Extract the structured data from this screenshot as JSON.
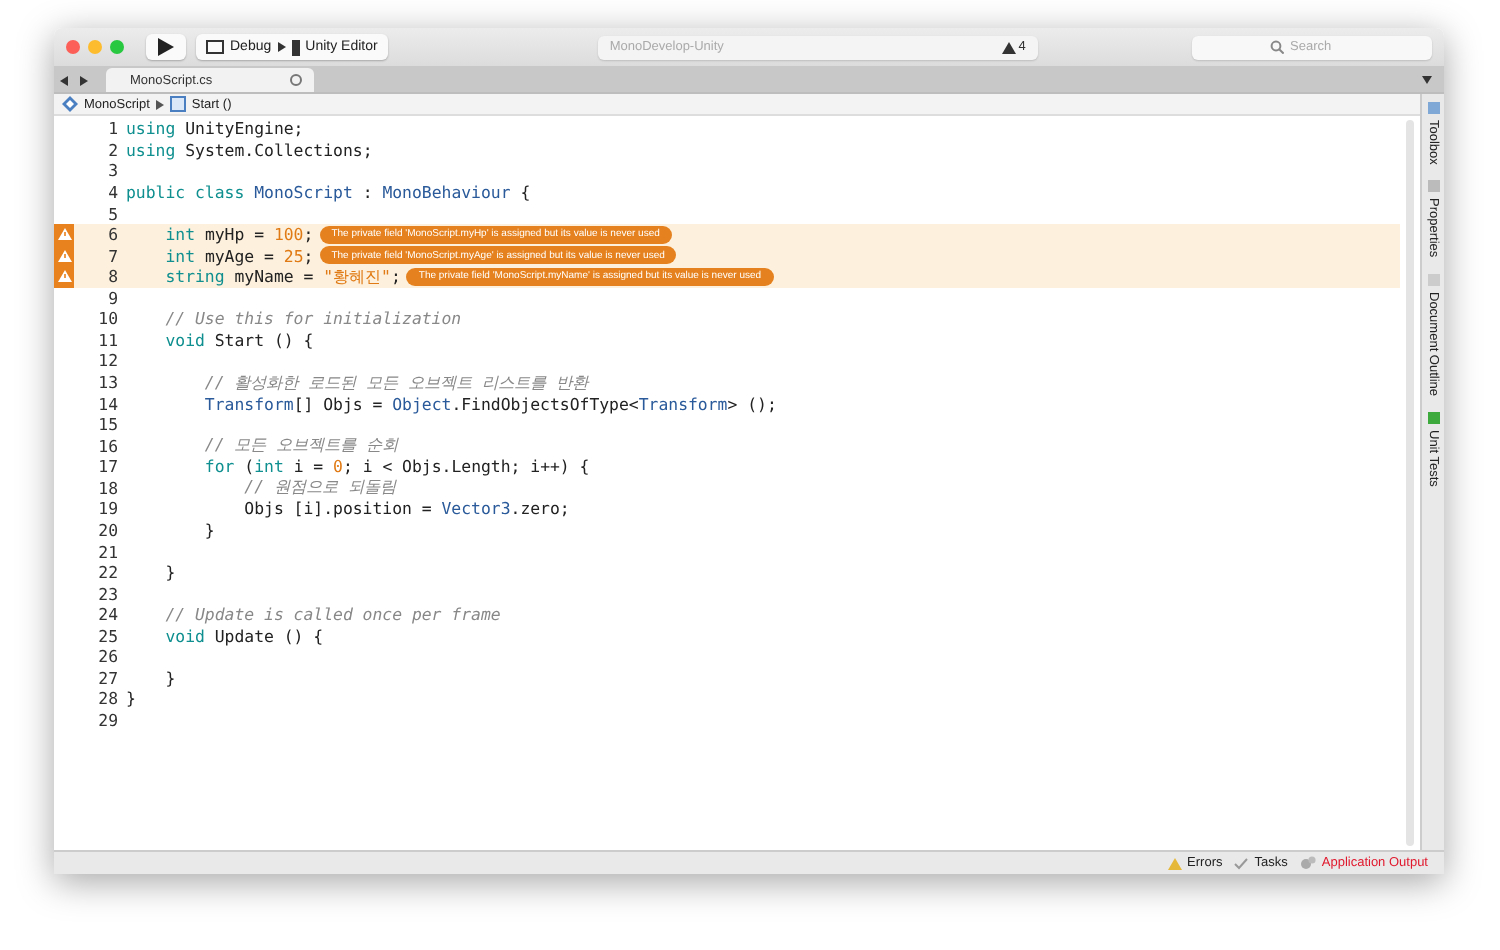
{
  "toolbar": {
    "configuration": "Debug",
    "target": "Unity Editor",
    "status": "MonoDevelop-Unity",
    "warning_count": "4",
    "search": {
      "placeholder": "Search"
    }
  },
  "tabs": [
    {
      "label": "MonoScript.cs",
      "selected": true
    }
  ],
  "breadcrumb": [
    "MonoScript",
    "Start ()"
  ],
  "lines": [
    {
      "number": "1",
      "warning": false,
      "tokens": [
        {
          "kind": "keyword",
          "text": "using"
        },
        {
          "kind": "text",
          "text": " UnityEngine;"
        }
      ]
    },
    {
      "number": "2",
      "warning": false,
      "tokens": [
        {
          "kind": "keyword",
          "text": "using"
        },
        {
          "kind": "text",
          "text": " System.Collections;"
        }
      ]
    },
    {
      "number": "3",
      "warning": false
    },
    {
      "number": "4",
      "warning": false,
      "tokens": [
        {
          "kind": "keyword",
          "text": "public class"
        },
        {
          "kind": "type",
          "text": " MonoScript"
        },
        {
          "kind": "text",
          "text": " : "
        },
        {
          "kind": "type",
          "text": "MonoBehaviour"
        },
        {
          "kind": "text",
          "text": " {"
        }
      ]
    },
    {
      "number": "5",
      "warning": false
    },
    {
      "number": "6",
      "warning": true,
      "message": "The private field 'MonoScript.myHp' is assigned but its value is never used",
      "tokens": [
        {
          "kind": "keyword",
          "text": "    int"
        },
        {
          "kind": "text",
          "text": " myHp = "
        },
        {
          "kind": "number",
          "text": "100"
        },
        {
          "kind": "text",
          "text": ";"
        }
      ]
    },
    {
      "number": "7",
      "warning": true,
      "message": "The private field 'MonoScript.myAge' is assigned but its value is never used",
      "tokens": [
        {
          "kind": "keyword",
          "text": "    int"
        },
        {
          "kind": "text",
          "text": " myAge = "
        },
        {
          "kind": "number",
          "text": "25"
        },
        {
          "kind": "text",
          "text": ";"
        }
      ]
    },
    {
      "number": "8",
      "warning": true,
      "message": "The private field 'MonoScript.myName' is assigned but its value is never used",
      "tokens": [
        {
          "kind": "keyword",
          "text": "    string"
        },
        {
          "kind": "text",
          "text": " myName = "
        },
        {
          "kind": "string",
          "text": "\"황혜진\""
        },
        {
          "kind": "text",
          "text": ";"
        }
      ]
    },
    {
      "number": "9",
      "warning": false
    },
    {
      "number": "10",
      "warning": false,
      "tokens": [
        {
          "kind": "comment",
          "text": "    // Use this for initialization"
        }
      ]
    },
    {
      "number": "11",
      "warning": false,
      "tokens": [
        {
          "kind": "keyword",
          "text": "    void"
        },
        {
          "kind": "text",
          "text": " Start () {"
        }
      ]
    },
    {
      "number": "12",
      "warning": false
    },
    {
      "number": "13",
      "warning": false,
      "tokens": [
        {
          "kind": "comment",
          "text": "        // 활성화한 로드된 모든 오브젝트 리스트를 반환"
        }
      ]
    },
    {
      "number": "14",
      "warning": false,
      "tokens": [
        {
          "kind": "type",
          "text": "        Transform"
        },
        {
          "kind": "text",
          "text": "[] Objs = "
        },
        {
          "kind": "type",
          "text": "Object"
        },
        {
          "kind": "text",
          "text": ".FindObjectsOfType<"
        },
        {
          "kind": "type",
          "text": "Transform"
        },
        {
          "kind": "text",
          "text": "> ();"
        }
      ]
    },
    {
      "number": "15",
      "warning": false
    },
    {
      "number": "16",
      "warning": false,
      "tokens": [
        {
          "kind": "comment",
          "text": "        // 모든 오브젝트를 순회"
        }
      ]
    },
    {
      "number": "17",
      "warning": false,
      "tokens": [
        {
          "kind": "keyword",
          "text": "        for"
        },
        {
          "kind": "text",
          "text": " ("
        },
        {
          "kind": "keyword",
          "text": "int"
        },
        {
          "kind": "text",
          "text": " i = "
        },
        {
          "kind": "number",
          "text": "0"
        },
        {
          "kind": "text",
          "text": "; i < Objs.Length; i++) {"
        }
      ]
    },
    {
      "number": "18",
      "warning": false,
      "tokens": [
        {
          "kind": "comment",
          "text": "            // 원점으로 되돌림"
        }
      ]
    },
    {
      "number": "19",
      "warning": false,
      "tokens": [
        {
          "kind": "text",
          "text": "            Objs [i].position = "
        },
        {
          "kind": "type",
          "text": "Vector3"
        },
        {
          "kind": "text",
          "text": ".zero;"
        }
      ]
    },
    {
      "number": "20",
      "warning": false,
      "tokens": [
        {
          "kind": "text",
          "text": "        }"
        }
      ]
    },
    {
      "number": "21",
      "warning": false
    },
    {
      "number": "22",
      "warning": false,
      "tokens": [
        {
          "kind": "text",
          "text": "    }"
        }
      ]
    },
    {
      "number": "23",
      "warning": false
    },
    {
      "number": "24",
      "warning": false,
      "tokens": [
        {
          "kind": "comment",
          "text": "    // Update is called once per frame"
        }
      ]
    },
    {
      "number": "25",
      "warning": false,
      "tokens": [
        {
          "kind": "keyword",
          "text": "    void"
        },
        {
          "kind": "text",
          "text": " Update () {"
        }
      ]
    },
    {
      "number": "26",
      "warning": false
    },
    {
      "number": "27",
      "warning": false,
      "tokens": [
        {
          "kind": "text",
          "text": "    }"
        }
      ]
    },
    {
      "number": "28",
      "warning": false,
      "tokens": [
        {
          "kind": "text",
          "text": "}"
        }
      ]
    },
    {
      "number": "29",
      "warning": false
    }
  ],
  "side_pads": [
    "Toolbox",
    "Properties",
    "Document Outline",
    "Unit Tests"
  ],
  "status_bar": [
    {
      "kind": "errors",
      "label": "Errors",
      "color": "#222222"
    },
    {
      "kind": "tasks",
      "label": "Tasks",
      "color": "#222222"
    },
    {
      "kind": "output",
      "label": "Application Output",
      "color": "#e0182d"
    }
  ]
}
